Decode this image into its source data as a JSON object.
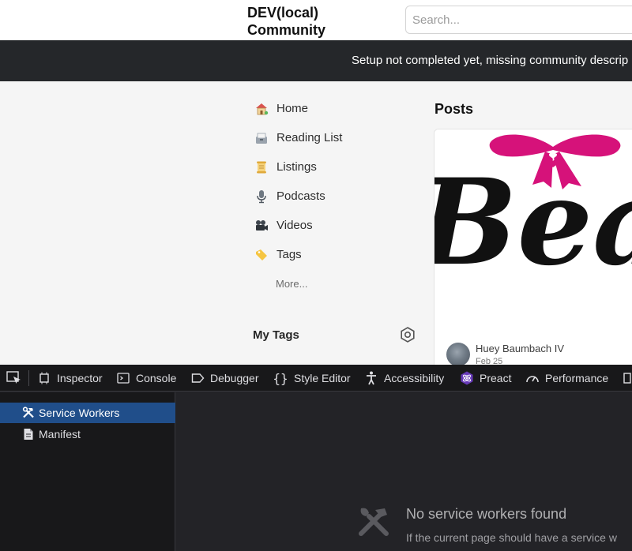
{
  "header": {
    "logo": "DEV(local) Community",
    "search_placeholder": "Search..."
  },
  "banner": {
    "text": "Setup not completed yet, missing community descrip"
  },
  "nav": {
    "items": [
      {
        "label": "Home",
        "icon": "house-icon"
      },
      {
        "label": "Reading List",
        "icon": "card-file-box-icon"
      },
      {
        "label": "Listings",
        "icon": "scroll-icon"
      },
      {
        "label": "Podcasts",
        "icon": "microphone-icon"
      },
      {
        "label": "Videos",
        "icon": "film-projector-icon"
      },
      {
        "label": "Tags",
        "icon": "label-tag-icon"
      }
    ],
    "more": "More...",
    "my_tags": "My Tags"
  },
  "posts": {
    "title": "Posts",
    "card": {
      "cover_text": "Beau",
      "author": "Huey Baumbach IV",
      "date": "Feb 25"
    }
  },
  "devtools": {
    "tabs": [
      {
        "label": "Inspector",
        "icon": "inspector-icon"
      },
      {
        "label": "Console",
        "icon": "console-icon"
      },
      {
        "label": "Debugger",
        "icon": "debugger-icon"
      },
      {
        "label": "Style Editor",
        "icon": "braces-icon"
      },
      {
        "label": "Accessibility",
        "icon": "accessibility-icon"
      },
      {
        "label": "Preact",
        "icon": "preact-icon"
      },
      {
        "label": "Performance",
        "icon": "performance-icon"
      }
    ],
    "sidebar": [
      {
        "label": "Service Workers",
        "icon": "hammer-wrench-icon",
        "active": true
      },
      {
        "label": "Manifest",
        "icon": "document-icon",
        "active": false
      }
    ],
    "empty": {
      "title": "No service workers found",
      "subtitle": "If the current page should have a service w"
    }
  },
  "colors": {
    "banner_bg": "#25272a",
    "devtools_bg": "#232327",
    "devtools_toolbar_bg": "#18181a",
    "selection_blue": "#204e8a",
    "bow_pink": "#d6127a"
  }
}
